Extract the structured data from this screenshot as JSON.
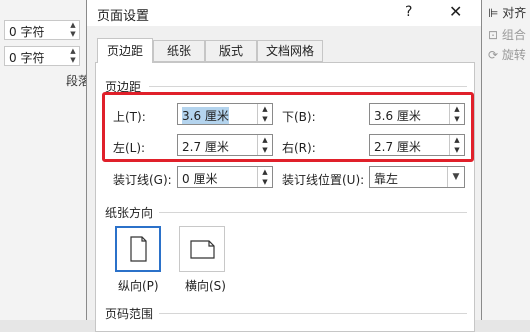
{
  "background": {
    "left_spinners": [
      "0 字符",
      "0 字符"
    ],
    "left_caption": "段落",
    "right_items": [
      "对齐",
      "组合",
      "旋转"
    ]
  },
  "dialog": {
    "title": "页面设置",
    "help": "?",
    "close": "✕",
    "tabs": [
      "页边距",
      "纸张",
      "版式",
      "文档网格"
    ],
    "margins_section": "页边距",
    "top_label": "上(T):",
    "top_value": "3.6 厘米",
    "bottom_label": "下(B):",
    "bottom_value": "3.6 厘米",
    "left_label": "左(L):",
    "left_value": "2.7 厘米",
    "right_label": "右(R):",
    "right_value": "2.7 厘米",
    "gutter_label": "装订线(G):",
    "gutter_value": "0 厘米",
    "gutter_pos_label": "装订线位置(U):",
    "gutter_pos_value": "靠左",
    "orientation_section": "纸张方向",
    "portrait_label": "纵向(P)",
    "landscape_label": "横向(S)",
    "pages_section": "页码范围"
  },
  "colors": {
    "highlight": "#e0202a",
    "selection": "#b4d4ee",
    "active_orientation": "#2b71c9"
  }
}
